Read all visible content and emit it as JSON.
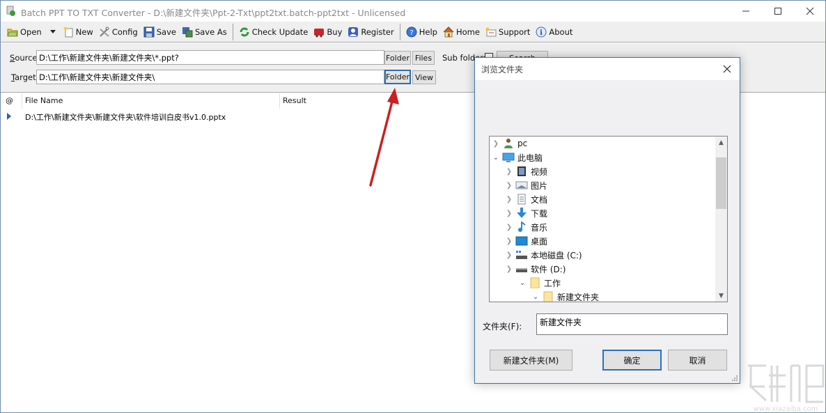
{
  "window": {
    "title": "Batch PPT TO TXT Converter - D:\\新建文件夹\\Ppt-2-Txt\\ppt2txt.batch-ppt2txt - Unlicensed",
    "app_icon": "converter-app-icon",
    "controls": [
      "minimize-icon",
      "maximize-icon",
      "close-icon"
    ]
  },
  "toolbar": {
    "items": [
      {
        "label": "Open",
        "icon": "open-folder-icon"
      },
      {
        "label": "New",
        "icon": "new-file-icon"
      },
      {
        "label": "Config",
        "icon": "tools-icon"
      },
      {
        "label": "Save",
        "icon": "floppy-disk-icon"
      },
      {
        "label": "Save As",
        "icon": "save-as-icon"
      },
      {
        "label": "Check Update",
        "icon": "refresh-icon"
      },
      {
        "label": "Buy",
        "icon": "shopping-cart-icon"
      },
      {
        "label": "Register",
        "icon": "user-icon"
      },
      {
        "label": "Help",
        "icon": "help-icon"
      },
      {
        "label": "Home",
        "icon": "home-icon"
      },
      {
        "label": "Support",
        "icon": "support-envelope-icon"
      },
      {
        "label": "About",
        "icon": "info-icon"
      }
    ]
  },
  "params": {
    "source_label_prefix": "S",
    "source_label_rest": "ource",
    "source_value": "D:\\工作\\新建文件夹\\新建文件夹\\*.ppt?",
    "target_label_prefix": "T",
    "target_label_rest": "arget",
    "target_value": "D:\\工作\\新建文件夹\\新建文件夹\\",
    "source_folder_btn": "Folder",
    "source_files_btn": "Files",
    "subfolders_label": "Sub folders",
    "subfolders_checked": false,
    "search_btn": "Search",
    "target_folder_btn": "Folder",
    "target_view_btn": "View"
  },
  "list": {
    "columns": [
      "@",
      "File Name",
      "Result"
    ],
    "rows": [
      {
        "file_name": "D:\\工作\\新建文件夹\\新建文件夹\\软件培训白皮书v1.0.pptx",
        "result": ""
      }
    ]
  },
  "dialog": {
    "title": "浏览文件夹",
    "tree": [
      {
        "label": "pc",
        "icon": "user-folder-icon",
        "level": 0,
        "expanded": false
      },
      {
        "label": "此电脑",
        "icon": "computer-icon",
        "level": 0,
        "expanded": true
      },
      {
        "label": "视频",
        "icon": "video-icon",
        "level": 1,
        "expanded": false
      },
      {
        "label": "图片",
        "icon": "pictures-icon",
        "level": 1,
        "expanded": false
      },
      {
        "label": "文档",
        "icon": "documents-icon",
        "level": 1,
        "expanded": false
      },
      {
        "label": "下载",
        "icon": "download-icon",
        "level": 1,
        "expanded": false
      },
      {
        "label": "音乐",
        "icon": "music-icon",
        "level": 1,
        "expanded": false
      },
      {
        "label": "桌面",
        "icon": "desktop-icon",
        "level": 1,
        "expanded": false
      },
      {
        "label": "本地磁盘 (C:)",
        "icon": "system-drive-icon",
        "level": 1,
        "expanded": false
      },
      {
        "label": "软件 (D:)",
        "icon": "drive-icon",
        "level": 1,
        "expanded": true
      },
      {
        "label": "工作",
        "icon": "folder-icon",
        "level": 2,
        "expanded": true
      },
      {
        "label": "新建文件夹",
        "icon": "folder-icon",
        "level": 3,
        "expanded": true
      }
    ],
    "folder_label": "文件夹(F):",
    "folder_value": "新建文件夹",
    "new_folder_btn": "新建文件夹(M)",
    "ok_btn": "确定",
    "cancel_btn": "取消"
  },
  "colors": {
    "annotation_arrow": "#cc1f1f",
    "focus_border": "#2c6fa8",
    "dialog_border": "#3a73a8"
  }
}
